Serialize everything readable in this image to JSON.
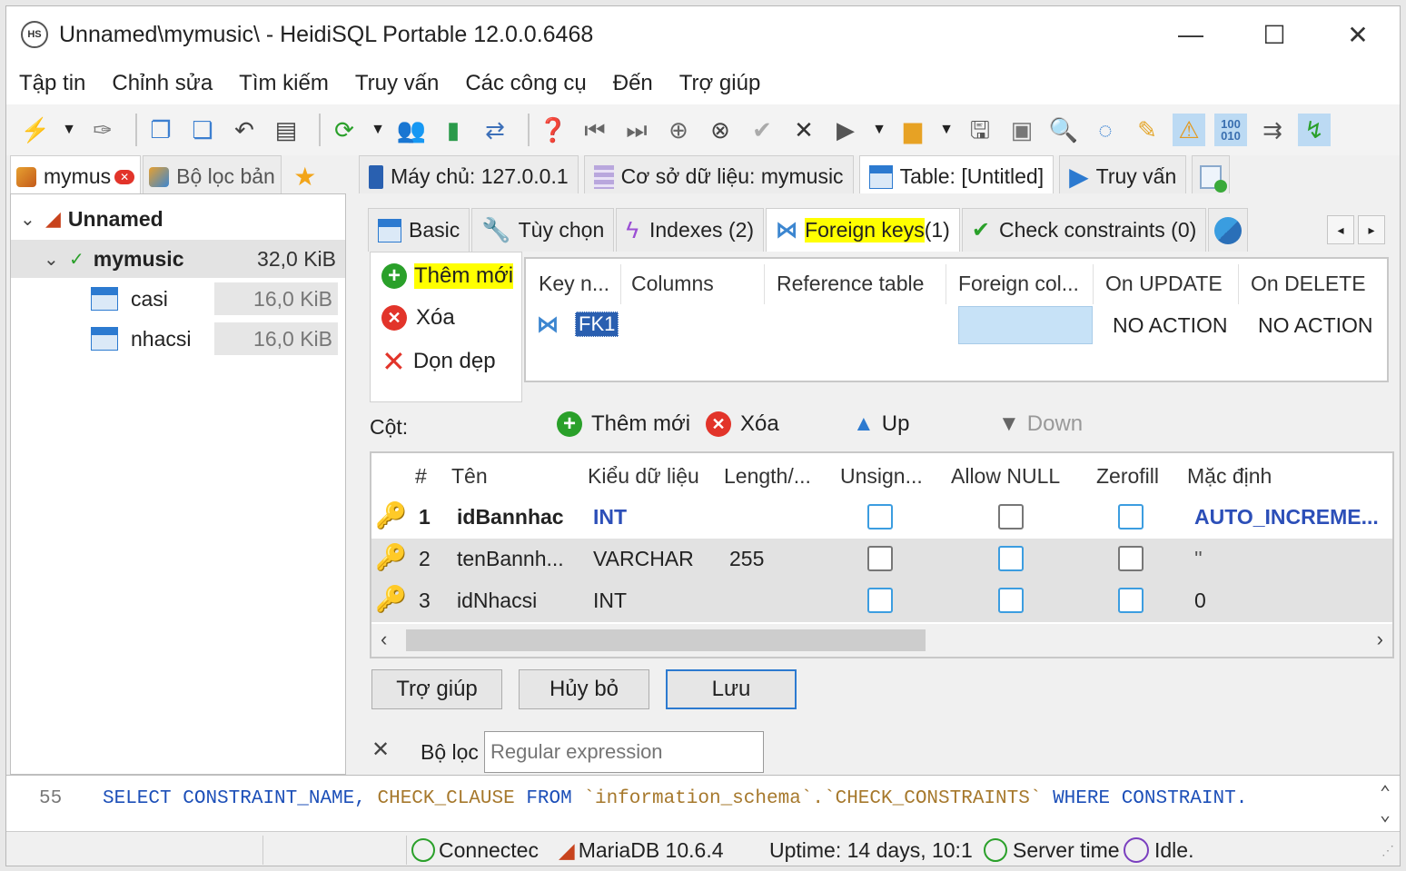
{
  "window": {
    "title": "Unnamed\\mymusic\\ - HeidiSQL Portable 12.0.0.6468",
    "app_icon_text": "HS",
    "minimize": "—",
    "maximize": "☐",
    "close": "✕"
  },
  "menu": [
    "Tập tin",
    "Chỉnh sửa",
    "Tìm kiếm",
    "Truy vấn",
    "Các công cụ",
    "Đến",
    "Trợ giúp"
  ],
  "left_tabs": [
    {
      "label": "mymus",
      "icon": "session-icon"
    },
    {
      "label": "Bộ lọc bản",
      "icon": "filter-icon"
    }
  ],
  "main_tabs": [
    {
      "label": "Máy chủ: 127.0.0.1",
      "icon": "server-icon"
    },
    {
      "label": "Cơ sở dữ liệu: mymusic",
      "icon": "database-icon"
    },
    {
      "label": "Table: [Untitled]",
      "icon": "table-icon"
    },
    {
      "label": "Truy vấn",
      "icon": "query-play-icon"
    }
  ],
  "tree": {
    "root": "Unnamed",
    "db": {
      "name": "mymusic",
      "size": "32,0 KiB"
    },
    "tables": [
      {
        "name": "casi",
        "size": "16,0 KiB"
      },
      {
        "name": "nhacsi",
        "size": "16,0 KiB"
      }
    ]
  },
  "subtabs": [
    {
      "label": "Basic"
    },
    {
      "label": "Tùy chọn"
    },
    {
      "label": "Indexes (2)"
    },
    {
      "label_main": "Foreign keys",
      "label_count": " (1)"
    },
    {
      "label": "Check constraints (0)"
    }
  ],
  "fk_actions": {
    "add": "Thêm mới",
    "delete": "Xóa",
    "clean": "Dọn dẹp"
  },
  "fk_table": {
    "headers": [
      "Key n...",
      "Columns",
      "Reference table",
      "Foreign col...",
      "On UPDATE",
      "On DELETE"
    ],
    "row": {
      "key": "FK1",
      "on_update": "NO ACTION",
      "on_delete": "NO ACTION"
    }
  },
  "columns_bar": {
    "label": "Cột:",
    "add": "Thêm mới",
    "delete": "Xóa",
    "up": "Up",
    "down": "Down"
  },
  "col_table": {
    "headers": [
      "#",
      "Tên",
      "Kiểu dữ liệu",
      "Length/...",
      "Unsign...",
      "Allow NULL",
      "Zerofill",
      "Mặc định"
    ],
    "rows": [
      {
        "num": "1",
        "name": "idBannhac",
        "type": "INT",
        "length": "",
        "default": "AUTO_INCREME..."
      },
      {
        "num": "2",
        "name": "tenBannh...",
        "type": "VARCHAR",
        "length": "255",
        "default": "''"
      },
      {
        "num": "3",
        "name": "idNhacsi",
        "type": "INT",
        "length": "",
        "default": "0"
      }
    ]
  },
  "buttons": {
    "help": "Trợ giúp",
    "cancel": "Hủy bỏ",
    "save": "Lưu"
  },
  "filter": {
    "label": "Bộ lọc",
    "placeholder": "Regular expression"
  },
  "sql_log": {
    "line": "55",
    "kw1": "SELECT",
    "p1": "CONSTRAINT_NAME,",
    "p2": "CHECK_CLAUSE",
    "kw2": "FROM",
    "p3": "`information_schema`.`CHECK_CONSTRAINTS`",
    "kw3": "WHERE",
    "p4": "CONSTRAINT."
  },
  "status": {
    "connected": "Connectec",
    "server": "MariaDB 10.6.4",
    "uptime": "Uptime: 14 days, 10:1",
    "server_time": "Server time",
    "idle": "Idle."
  },
  "colors": {
    "highlight": "#ffff00",
    "selection": "#c7e2f7",
    "sql_keyword": "#1c4fb8",
    "sql_ident": "#a6782c"
  }
}
